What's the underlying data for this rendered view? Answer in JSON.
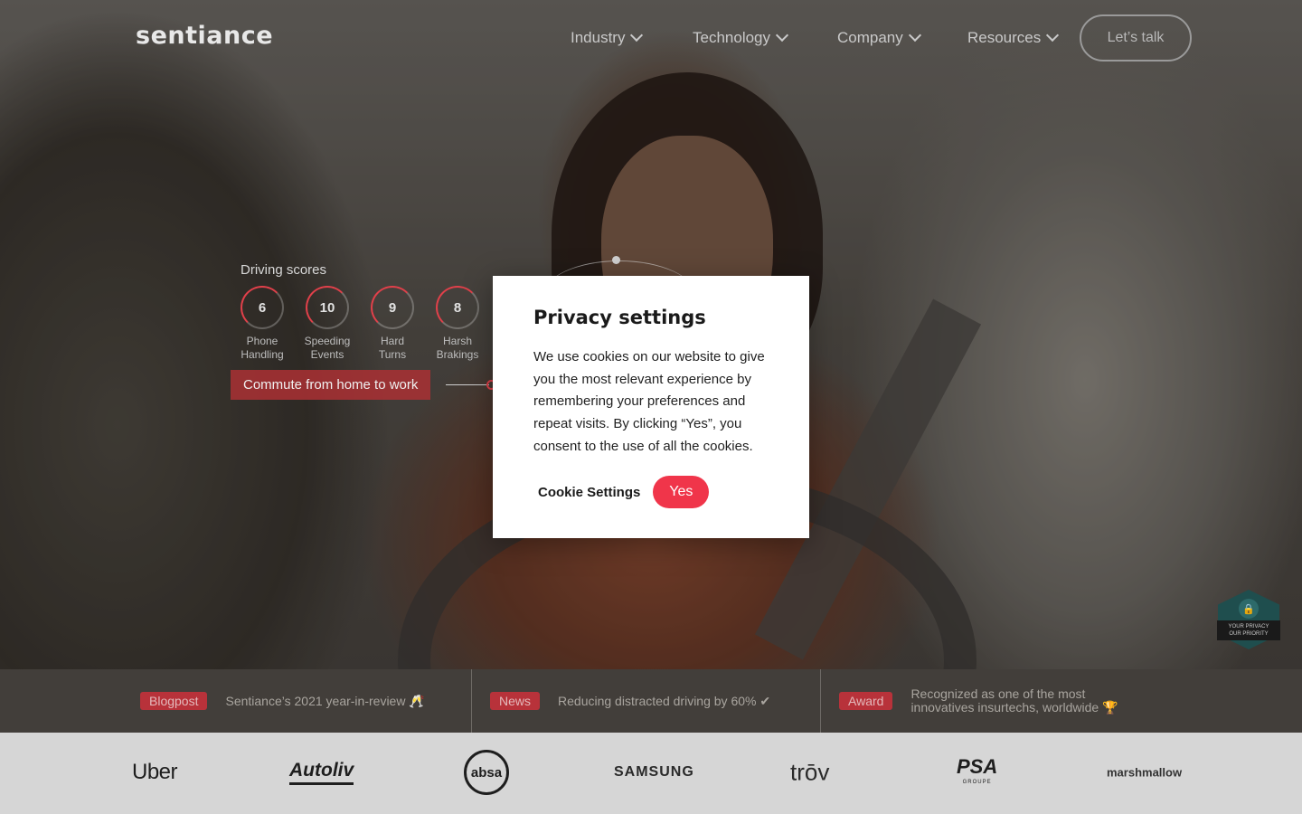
{
  "header": {
    "logo": "sentiance",
    "nav": [
      {
        "label": "Industry"
      },
      {
        "label": "Technology"
      },
      {
        "label": "Company"
      },
      {
        "label": "Resources"
      }
    ],
    "cta_label": "Let’s talk"
  },
  "hero": {
    "scores_title": "Driving scores",
    "scores": [
      {
        "value": "6",
        "label_line1": "Phone",
        "label_line2": "Handling"
      },
      {
        "value": "10",
        "label_line1": "Speeding",
        "label_line2": "Events"
      },
      {
        "value": "9",
        "label_line1": "Hard",
        "label_line2": "Turns"
      },
      {
        "value": "8",
        "label_line1": "Harsh",
        "label_line2": "Brakings"
      }
    ],
    "trip_label": "Commute from home to work"
  },
  "ticker": [
    {
      "tag": "Blogpost",
      "text": "Sentiance’s 2021 year-in-review 🥂"
    },
    {
      "tag": "News",
      "text": "Reducing distracted driving by 60% ✔"
    },
    {
      "tag": "Award",
      "text_line1": "Recognized as one of the most",
      "text_line2": "innovatives insurtechs, worldwide 🏆"
    }
  ],
  "privacy_badge": {
    "line1": "YOUR PRIVACY",
    "line2": "OUR PRIORITY"
  },
  "client_logos": [
    "Uber",
    "Autoliv",
    "absa",
    "SAMSUNG",
    "trōv",
    "PSA",
    "GROUPE",
    "marshmallow"
  ],
  "modal": {
    "title": "Privacy settings",
    "body": "We use cookies on our website to give you the most relevant experience by remembering your preferences and repeat visits. By clicking “Yes”, you consent to the use of all the cookies.",
    "settings_label": "Cookie Settings",
    "accept_label": "Yes"
  },
  "colors": {
    "accent": "#f0354a",
    "tag": "#b8323a",
    "ticker_bg": "#423e3a",
    "logos_bg": "#d6d6d6"
  }
}
